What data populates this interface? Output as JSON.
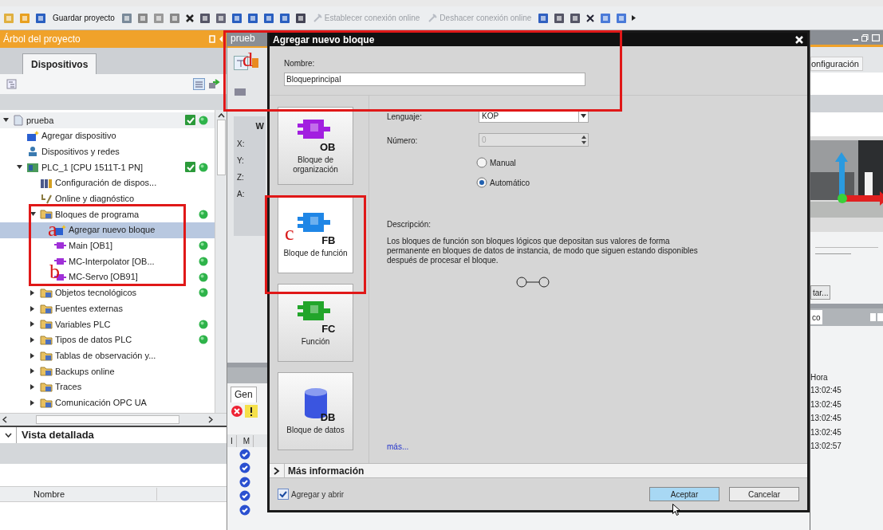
{
  "toolbar": {
    "buttons": [
      {
        "label": "Guardar proyecto",
        "disabled": false
      },
      {
        "label": "Establecer conexión online",
        "disabled": true
      },
      {
        "label": "Deshacer conexión online",
        "disabled": true
      }
    ]
  },
  "project_tree": {
    "title": "Árbol del proyecto",
    "tab": "Dispositivos",
    "items": [
      {
        "label": "prueba",
        "kind": "project",
        "expanded": true,
        "selected": false,
        "consistent": true,
        "online": true,
        "children": [
          {
            "label": "Agregar dispositivo",
            "kind": "add",
            "selected": false
          },
          {
            "label": "Dispositivos y redes",
            "kind": "network",
            "selected": false
          },
          {
            "label": "PLC_1 [CPU 1511T-1 PN]",
            "kind": "plc",
            "expanded": true,
            "selected": false,
            "consistent": true,
            "online": true,
            "children": [
              {
                "label": "Configuración de dispos...",
                "kind": "config",
                "selected": false
              },
              {
                "label": "Online y diagnóstico",
                "kind": "diag",
                "selected": false
              },
              {
                "label": "Bloques de programa",
                "kind": "folder",
                "expanded": true,
                "selected": false,
                "online": true,
                "children": [
                  {
                    "label": "Agregar nuevo bloque",
                    "kind": "add",
                    "selected": true
                  },
                  {
                    "label": "Main [OB1]",
                    "kind": "block",
                    "selected": false,
                    "online": true
                  },
                  {
                    "label": "MC-Interpolator [OB...",
                    "kind": "block",
                    "selected": false,
                    "online": true
                  },
                  {
                    "label": "MC-Servo [OB91]",
                    "kind": "block",
                    "selected": false,
                    "online": true
                  }
                ]
              },
              {
                "label": "Objetos tecnológicos",
                "kind": "folder",
                "expanded": false,
                "selected": false,
                "online": true
              },
              {
                "label": "Fuentes externas",
                "kind": "folder",
                "expanded": false,
                "selected": false
              },
              {
                "label": "Variables PLC",
                "kind": "folder",
                "expanded": false,
                "selected": false,
                "online": true
              },
              {
                "label": "Tipos de datos PLC",
                "kind": "folder",
                "expanded": false,
                "selected": false,
                "online": true
              },
              {
                "label": "Tablas de observación y...",
                "kind": "folder",
                "expanded": false,
                "selected": false
              },
              {
                "label": "Backups online",
                "kind": "folder",
                "expanded": false,
                "selected": false
              },
              {
                "label": "Traces",
                "kind": "folder",
                "expanded": false,
                "selected": false
              },
              {
                "label": "Comunicación OPC UA",
                "kind": "folder",
                "expanded": false,
                "selected": false
              }
            ]
          }
        ]
      }
    ]
  },
  "detail_view": {
    "title": "Vista detallada",
    "column": "Nombre"
  },
  "editor": {
    "tab": "prueb",
    "heading": "W",
    "fields": [
      "X:",
      "Y:",
      "Z:",
      "A:"
    ]
  },
  "inspector": {
    "tab": "Gen",
    "columns": [
      "I",
      "M"
    ],
    "rows": [
      {
        "success": true
      },
      {
        "success": true
      },
      {
        "success": true
      },
      {
        "success": true
      },
      {
        "success": true
      }
    ]
  },
  "right_pane": {
    "tab": "onfiguración",
    "button": "tar...",
    "tab2": "co",
    "column": "Hora",
    "times": [
      "13:02:45",
      "13:02:45",
      "13:02:45",
      "13:02:45",
      "13:02:57"
    ]
  },
  "dialog": {
    "title": "Agregar nuevo bloque",
    "name_label": "Nombre:",
    "name_value": "Bloqueprincipal",
    "block_types": [
      {
        "code": "OB",
        "label": "Bloque de organización",
        "color": "#a21fe0",
        "selected": false
      },
      {
        "code": "FB",
        "label": "Bloque de función",
        "color": "#1f86e6",
        "selected": true
      },
      {
        "code": "FC",
        "label": "Función",
        "color": "#22a52a",
        "selected": false
      },
      {
        "code": "DB",
        "label": "Bloque de datos",
        "color": "#3a55e0",
        "selected": false
      }
    ],
    "language_label": "Lenguaje:",
    "language": "KOP",
    "number_label": "Número:",
    "number": "0",
    "number_modes": [
      {
        "label": "Manual",
        "selected": false
      },
      {
        "label": "Automático",
        "selected": true
      }
    ],
    "description_label": "Descripción:",
    "description": "Los bloques de función son bloques lógicos que depositan sus valores de forma permanente en bloques de datos de instancia, de modo que siguen estando disponibles después de procesar el bloque.",
    "more_link": "más...",
    "more_info": "Más información",
    "add_and_open": {
      "label": "Agregar y abrir",
      "checked": true
    },
    "buttons": [
      {
        "label": "Aceptar",
        "kind": "primary"
      },
      {
        "label": "Cancelar",
        "kind": "secondary"
      }
    ]
  },
  "annotations": [
    {
      "label": "a"
    },
    {
      "label": "b"
    },
    {
      "label": "c"
    },
    {
      "label": "d"
    }
  ]
}
